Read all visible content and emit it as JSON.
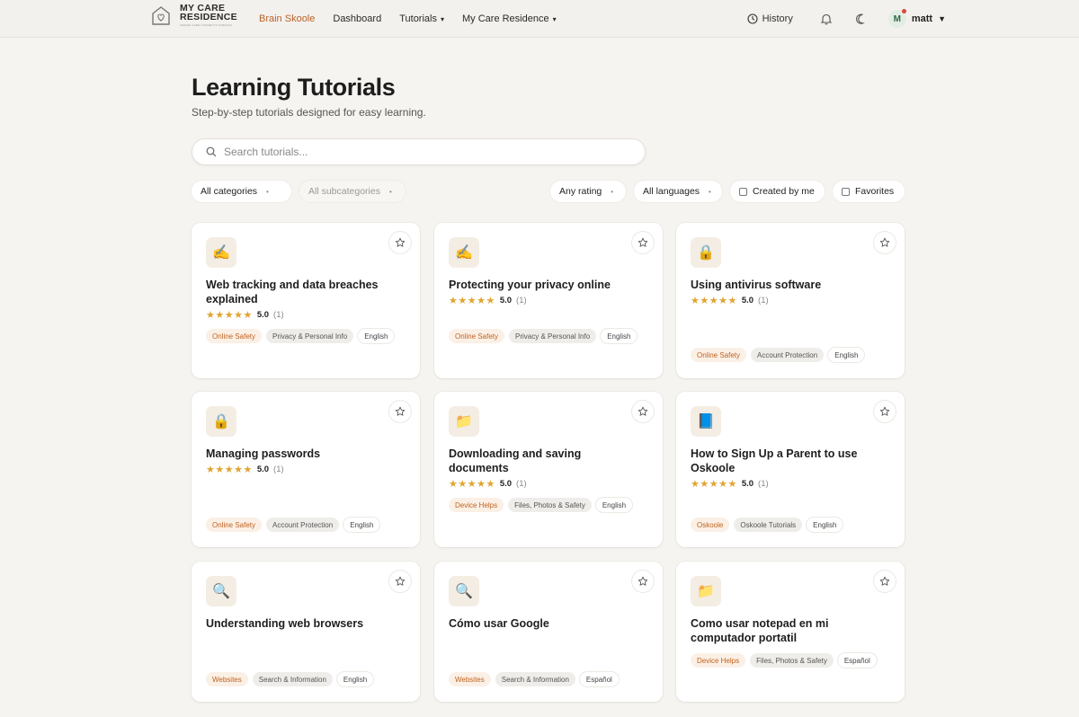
{
  "nav": {
    "logo_line1": "MY CARE",
    "logo_line2": "RESIDENCE",
    "logo_tagline": "WHERE CARE CONNECTS FAMILIES",
    "links": [
      {
        "label": "Brain Skoole",
        "active": true
      },
      {
        "label": "Dashboard"
      },
      {
        "label": "Tutorials",
        "caret": "▾"
      },
      {
        "label": "My Care Residence",
        "caret": "▾"
      }
    ],
    "history_label": "History",
    "user_initial": "M",
    "user_name": "matt",
    "user_caret": "▼"
  },
  "header": {
    "title": "Learning Tutorials",
    "subtitle": "Step-by-step tutorials designed for easy learning."
  },
  "search": {
    "placeholder": "Search tutorials..."
  },
  "filters": {
    "category": "All categories",
    "subcategory": "All subcategories",
    "rating": "Any rating",
    "language": "All languages",
    "created_by_me": "Created by me",
    "favorites": "Favorites",
    "dot": "•"
  },
  "colors": {
    "accent": "#b8612a",
    "star": "#e0a431",
    "category_tag_bg": "#fbf0e6"
  },
  "tutorials": [
    {
      "icon": "✍️",
      "icon_name": "writing-hand-icon",
      "title": "Web tracking and data breaches explained",
      "stars": "★★★★★",
      "score": "5.0",
      "count": "(1)",
      "category": "Online Safety",
      "subcategory": "Privacy & Personal Info",
      "language": "English"
    },
    {
      "icon": "✍️",
      "icon_name": "writing-hand-icon",
      "title": "Protecting your privacy online",
      "stars": "★★★★★",
      "score": "5.0",
      "count": "(1)",
      "category": "Online Safety",
      "subcategory": "Privacy & Personal Info",
      "language": "English"
    },
    {
      "icon": "🔒",
      "icon_name": "lock-icon",
      "title": "Using antivirus software",
      "stars": "★★★★★",
      "score": "5.0",
      "count": "(1)",
      "category": "Online Safety",
      "subcategory": "Account Protection",
      "language": "English"
    },
    {
      "icon": "🔒",
      "icon_name": "lock-icon",
      "title": "Managing passwords",
      "stars": "★★★★★",
      "score": "5.0",
      "count": "(1)",
      "category": "Online Safety",
      "subcategory": "Account Protection",
      "language": "English"
    },
    {
      "icon": "📁",
      "icon_name": "folder-icon",
      "title": "Downloading and saving documents",
      "stars": "★★★★★",
      "score": "5.0",
      "count": "(1)",
      "category": "Device Helps",
      "subcategory": "Files, Photos & Safety",
      "language": "English"
    },
    {
      "icon": "📘",
      "icon_name": "book-icon",
      "title": "How to Sign Up a Parent to use Oskoole",
      "stars": "★★★★★",
      "score": "5.0",
      "count": "(1)",
      "category": "Oskoole",
      "subcategory": "Oskoole Tutorials",
      "language": "English"
    },
    {
      "icon": "🔍",
      "icon_name": "magnifier-icon",
      "title": "Understanding web browsers",
      "category": "Websites",
      "subcategory": "Search & Information",
      "language": "English"
    },
    {
      "icon": "🔍",
      "icon_name": "magnifier-icon",
      "title": "Cómo usar Google",
      "category": "Websites",
      "subcategory": "Search & Information",
      "language": "Español"
    },
    {
      "icon": "📁",
      "icon_name": "folder-icon",
      "title": "Como usar notepad en mi computador portatil",
      "category": "Device Helps",
      "subcategory": "Files, Photos & Safety",
      "language": "Español"
    }
  ]
}
